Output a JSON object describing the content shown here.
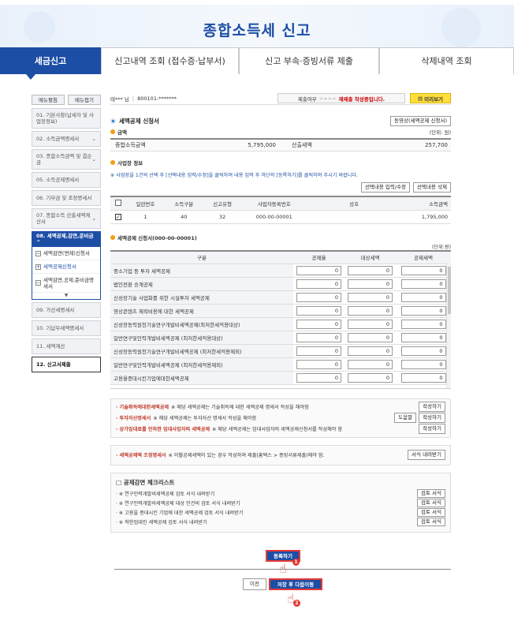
{
  "banner": {
    "title": "종합소득세 신고"
  },
  "tabs": [
    {
      "label": "세금신고",
      "active": true
    },
    {
      "label": "신고내역 조회 (접수증·납부서)"
    },
    {
      "label": "신고 부속·증빙서류 제출"
    },
    {
      "label": "삭제내역 조회"
    }
  ],
  "sidebar": {
    "toggle_open": "메뉴펼침",
    "toggle_close": "메뉴접기",
    "items": [
      {
        "label": "01. 기본사항(납세자 및 사업장정보)"
      },
      {
        "label": "02. 소득금액명세서"
      },
      {
        "label": "03. 종합소득금액 및 결손금"
      },
      {
        "label": "05. 소득공제명세서"
      },
      {
        "label": "06. 기부금 및 조정명세서"
      },
      {
        "label": "07. 종합소득 산출세액계산서"
      },
      {
        "label": "08. 세액공제,감면,준비금 ^"
      }
    ],
    "sub_items": [
      {
        "label": "세액감면(면제)신청서",
        "mark": "−"
      },
      {
        "label": "세액공제신청서",
        "mark": "+"
      },
      {
        "label": "세액감면,공제,준비금명세서",
        "mark": "−"
      }
    ],
    "items_after": [
      {
        "label": "09. 가산세명세서"
      },
      {
        "label": "10. 기납부세액명세서"
      },
      {
        "label": "11. 세액계산"
      },
      {
        "label": "12. 신고서제출"
      }
    ]
  },
  "header": {
    "name": "태*** 님",
    "id": "800101-*******",
    "status_label": "제출여부",
    ">>>": ">>>>",
    "status_value": "재제출 작성중입니다.",
    "preview": "미리보기"
  },
  "form": {
    "title": "세액공제 신청서",
    "video_btn": "동영상(세액공제 신청서)",
    "amount_section": "금액",
    "unit": "(단위: 원)",
    "total_income_label": "종합소득금액",
    "total_income": "5,795,000",
    "calc_tax_label": "산출세액",
    "calc_tax": "257,700",
    "biz_section": "사업장 정보",
    "biz_note": "※ 사업장을 1건씩 선택 후 [선택내용 입력/수정]을 클릭하여 내용 입력 후 하단의 [등록하기]를 클릭하여 주시기 바랍니다.",
    "edit_btn": "선택내용 입력/수정",
    "delete_btn": "선택내용 삭제",
    "biz_headers": [
      "일련번호",
      "소득구분",
      "신고유형",
      "사업자등록번호",
      "상호",
      "소득금액"
    ],
    "biz_rows": [
      {
        "no": "1",
        "type": "40",
        "report": "32",
        "regno": "000-00-00001",
        "name": "",
        "income": "1,795,000"
      }
    ],
    "credit_title": "세액공제 신청서(000-00-00001)",
    "credit_unit": "(단위:원)",
    "credit_headers": [
      "구분",
      "공제율",
      "대상세액",
      "공제세액"
    ],
    "credit_rows": [
      {
        "label": "중소기업 등 투자 세액공제",
        "rate": "0",
        "base": "0",
        "credit": "0"
      },
      {
        "label": "법인전환 승계공제",
        "rate": "0",
        "base": "0",
        "credit": "0"
      },
      {
        "label": "신성장기술 사업화를 위한 시설투자 세액공제",
        "rate": "0",
        "base": "0",
        "credit": "0"
      },
      {
        "label": "영상콘텐츠 제작비용에 대한 세액공제",
        "rate": "0",
        "base": "0",
        "credit": "0"
      },
      {
        "label": "신성장동력원천기술연구개발비세액공제(최저한세적용대상)",
        "rate": "0",
        "base": "0",
        "credit": "0"
      },
      {
        "label": "일반연구및인력개발비세액공제 (최저한세적용대상)",
        "rate": "0",
        "base": "0",
        "credit": "0"
      },
      {
        "label": "신성장동력원천기술연구개발비세액공제 (최저한세적용제외)",
        "rate": "0",
        "base": "0",
        "credit": "0"
      },
      {
        "label": "일반연구및인력개발비세액공제 (최저한세적용제외)",
        "rate": "0",
        "base": "0",
        "credit": "0"
      },
      {
        "label": "고용을증대시킨기업에대한세액공제",
        "rate": "0",
        "base": "0",
        "credit": "0"
      }
    ]
  },
  "notes": [
    {
      "title": "· 기술취득에대한세액공제",
      "text": "※ 해당 세액공제는 기술취득에 대한 세액공제 명세서 작성을 해야함",
      "buttons": [
        "작성하기"
      ]
    },
    {
      "title": "· 투자자산명세서",
      "text": "※ 해당 세액공제는 투자자산 명세서 작성을 해야함",
      "buttons": [
        "도움말",
        "작성하기"
      ]
    },
    {
      "title": "· 상가임대료를 인하한 임대사업자의 세액공제",
      "text": "※ 해당 세액공제는 임대사업자의 세액공제신청서를 작성해야 함",
      "buttons": [
        "작성하기"
      ]
    }
  ],
  "adjust": {
    "title": "· 세액공제액 조정명세서",
    "text": "※ 이월공제세액이 있는 경우 작성하여 제출(홈택스 > 증빙서류제출)해야 함.",
    "button": "서식 내려받기"
  },
  "checklist": {
    "title": "□ 공제감면 체크리스트",
    "items": [
      {
        "text": "· ※ 연구인력개발비세액공제 검토 서식 내려받기",
        "button": "검토 서식"
      },
      {
        "text": "· ※ 연구인력개발비세액공제 대상 인건비 검토 서식 내려받기",
        "button": "검토 서식"
      },
      {
        "text": "· ※ 고용을 증대시킨 기업에 대한 세액공제 검토 서식 내려받기",
        "button": "검토 서식"
      },
      {
        "text": "· ※ 착한임대인 세액공제 검토 서식 내려받기",
        "button": "검토 서식"
      }
    ]
  },
  "footer": {
    "register": "등록하기",
    "prev": "이전",
    "save_next": "저장 후 다음이동",
    "step1": "1",
    "step2": "2"
  },
  "colors": {
    "accent": "#1d4ea6",
    "warn": "#c0392b",
    "highlight": "#e53935"
  }
}
